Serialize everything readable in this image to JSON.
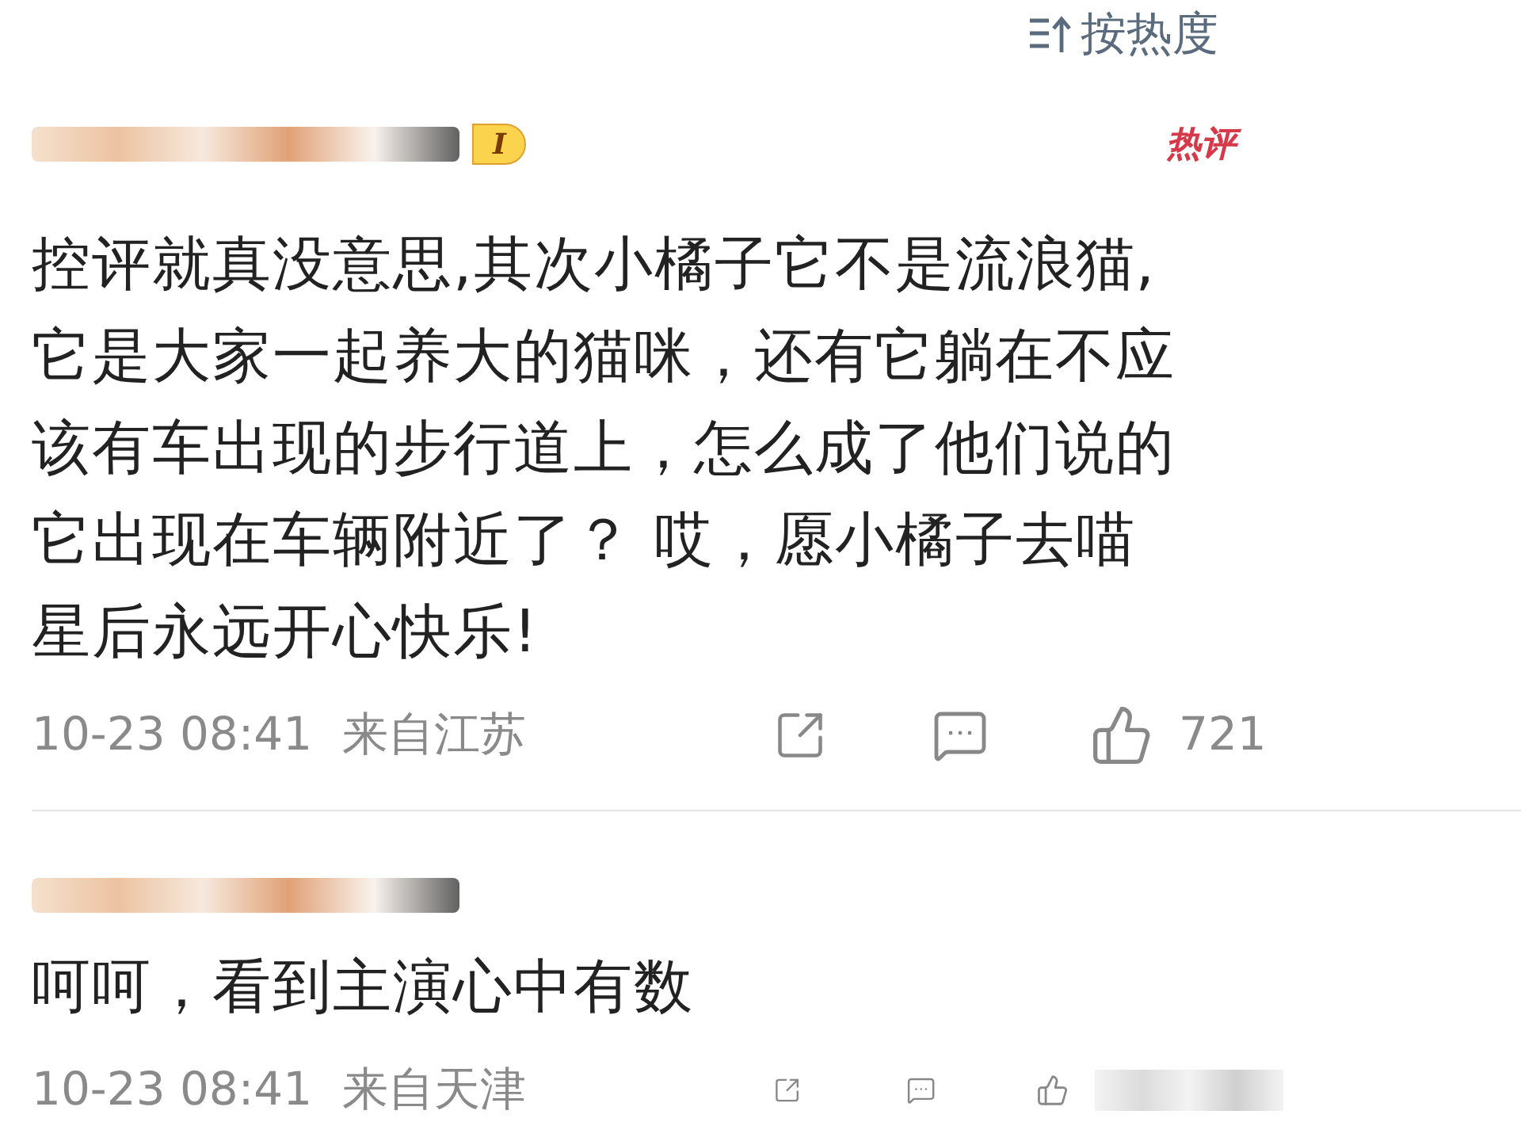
{
  "sort": {
    "label": "按热度"
  },
  "comments": [
    {
      "badge": "I",
      "hot_label": "热评",
      "text_lines": [
        "控评就真没意思,其次小橘子它不是流浪猫,",
        "它是大家一起养大的猫咪，还有它躺在不应",
        "该有车出现的步行道上，怎么成了他们说的",
        "它出现在车辆附近了？ 哎，愿小橘子去喵",
        "星后永远开心快乐!"
      ],
      "time": "10-23 08:41",
      "location": "来自江苏",
      "likes": "721"
    },
    {
      "text_lines": [
        "呵呵，看到主演心中有数"
      ],
      "time": "10-23 08:41",
      "location": "来自天津"
    }
  ]
}
